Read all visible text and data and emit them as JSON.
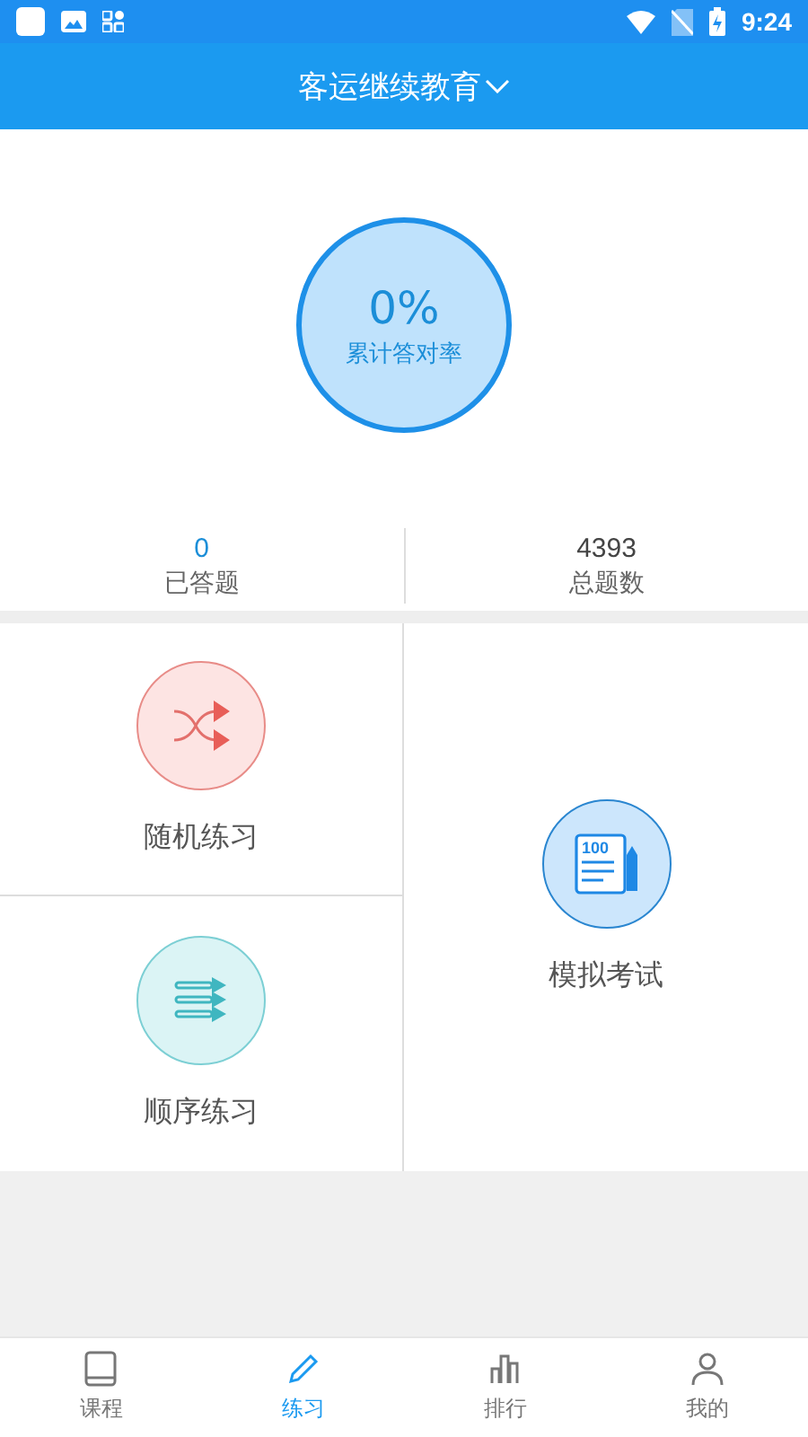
{
  "status_bar": {
    "time": "9:24"
  },
  "header": {
    "title": "客运继续教育"
  },
  "score": {
    "value": "0%",
    "label": "累计答对率"
  },
  "stats": [
    {
      "value": "0",
      "label": "已答题",
      "highlight": true
    },
    {
      "value": "4393",
      "label": "总题数",
      "highlight": false
    }
  ],
  "modes": [
    {
      "kind": "random",
      "label": "随机练习"
    },
    {
      "kind": "order",
      "label": "顺序练习"
    },
    {
      "kind": "exam",
      "label": "模拟考试",
      "icon_text": "100"
    }
  ],
  "tabs": [
    {
      "kind": "course",
      "label": "课程",
      "selected": false
    },
    {
      "kind": "practice",
      "label": "练习",
      "selected": true
    },
    {
      "kind": "rank",
      "label": "排行",
      "selected": false
    },
    {
      "kind": "mine",
      "label": "我的",
      "selected": false
    }
  ]
}
